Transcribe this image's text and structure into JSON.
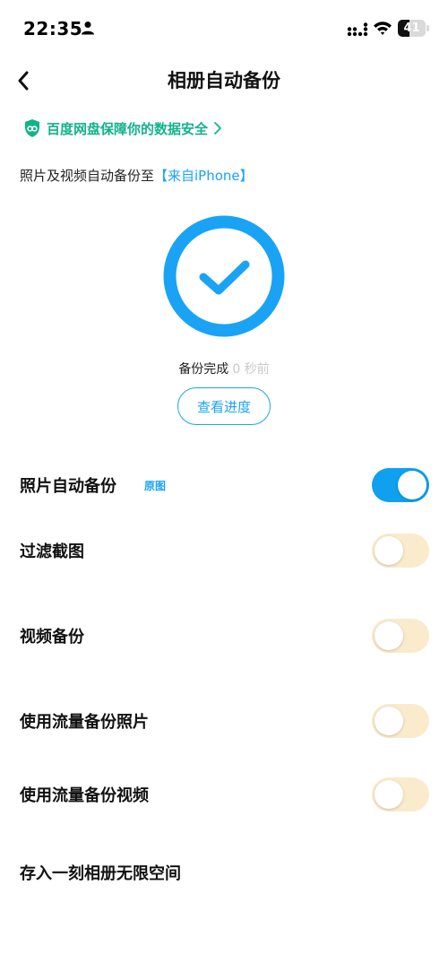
{
  "status_bar": {
    "time": "22:35",
    "battery": "41",
    "battery_level": 0.41,
    "icons": [
      "person-icon",
      "signal-icon",
      "wifi-icon",
      "battery-icon"
    ]
  },
  "nav": {
    "title": "相册自动备份",
    "back_icon": "chevron-left-icon"
  },
  "security_banner": {
    "text": "百度网盘保障你的数据安全",
    "icon": "shield-icon",
    "color": "#12b38b"
  },
  "backup_destination": {
    "prefix": "照片及视频自动备份至",
    "link": "【来自iPhone】"
  },
  "backup_status": {
    "icon": "checkmark-circle-icon",
    "status": "备份完成",
    "time_ago": "0 秒前",
    "progress_button": "查看进度"
  },
  "settings": [
    {
      "label": "照片自动备份",
      "badge": "原图",
      "enabled": true
    },
    {
      "label": "过滤截图",
      "enabled": false
    },
    {
      "label": "视频备份",
      "enabled": false
    },
    {
      "label": "使用流量备份照片",
      "enabled": false
    },
    {
      "label": "使用流量备份视频",
      "enabled": false
    },
    {
      "label": "存入一刻相册无限空间"
    }
  ],
  "colors": {
    "accent": "#1aa3f5",
    "toggle_on": "#0fa0f0",
    "toggle_off": "#faebcd",
    "security_green": "#12b38b"
  }
}
